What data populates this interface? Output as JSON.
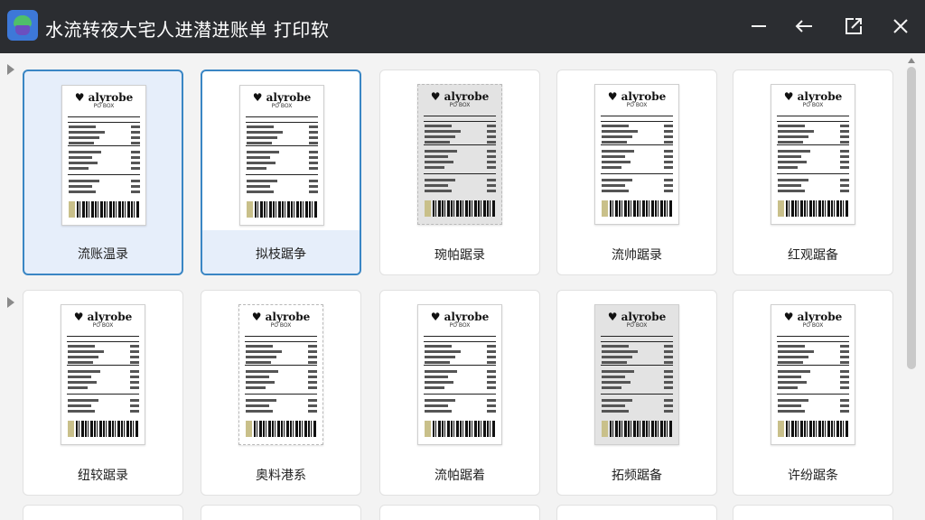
{
  "window": {
    "title": "水流转夜大宅人进潜进账单 打印软"
  },
  "icons": {
    "app": "app-logo-icon",
    "minimize": "minimize-icon",
    "back": "back-arrow-icon",
    "restore": "restore-window-icon",
    "close": "close-icon"
  },
  "receipt": {
    "brand": "♥ alyrobe",
    "sub": "PO BOX"
  },
  "templates": [
    {
      "label": "流账温录",
      "state": "selected"
    },
    {
      "label": "拟枝踞争",
      "state": "hover"
    },
    {
      "label": "琬帕踞录",
      "state": "normal"
    },
    {
      "label": "流帅踞录",
      "state": "normal"
    },
    {
      "label": "红观踞备",
      "state": "normal"
    },
    {
      "label": "纽较踞录",
      "state": "normal"
    },
    {
      "label": "奥料港系",
      "state": "normal"
    },
    {
      "label": "流帕踞着",
      "state": "normal"
    },
    {
      "label": "拓频踞备",
      "state": "normal"
    },
    {
      "label": "许纷踞条",
      "state": "normal"
    }
  ],
  "colors": {
    "titlebar": "#2b2d31",
    "selection": "#3a86c4",
    "selection_fill": "#e6eefa"
  }
}
